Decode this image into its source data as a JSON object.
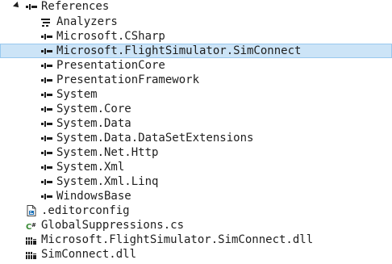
{
  "references": {
    "label": "References",
    "items": [
      {
        "label": "Analyzers",
        "icon": "analyzer-icon"
      },
      {
        "label": "Microsoft.CSharp",
        "icon": "reference-icon"
      },
      {
        "label": "Microsoft.FlightSimulator.SimConnect",
        "icon": "reference-icon",
        "selected": true
      },
      {
        "label": "PresentationCore",
        "icon": "reference-icon"
      },
      {
        "label": "PresentationFramework",
        "icon": "reference-icon"
      },
      {
        "label": "System",
        "icon": "reference-icon"
      },
      {
        "label": "System.Core",
        "icon": "reference-icon"
      },
      {
        "label": "System.Data",
        "icon": "reference-icon"
      },
      {
        "label": "System.Data.DataSetExtensions",
        "icon": "reference-icon"
      },
      {
        "label": "System.Net.Http",
        "icon": "reference-icon"
      },
      {
        "label": "System.Xml",
        "icon": "reference-icon"
      },
      {
        "label": "System.Xml.Linq",
        "icon": "reference-icon"
      },
      {
        "label": "WindowsBase",
        "icon": "reference-icon"
      }
    ]
  },
  "files": [
    {
      "label": ".editorconfig",
      "icon": "editorconfig-file-icon"
    },
    {
      "label": "GlobalSuppressions.cs",
      "icon": "csharp-file-icon"
    },
    {
      "label": "Microsoft.FlightSimulator.SimConnect.dll",
      "icon": "dll-file-icon"
    },
    {
      "label": "SimConnect.dll",
      "icon": "dll-file-icon"
    }
  ],
  "colors": {
    "selection_bg": "#cce4f7",
    "selection_border": "#99c9ef",
    "text": "#1e1e1e",
    "csharp_green": "#388a34",
    "file_blue": "#1a6fb5"
  }
}
